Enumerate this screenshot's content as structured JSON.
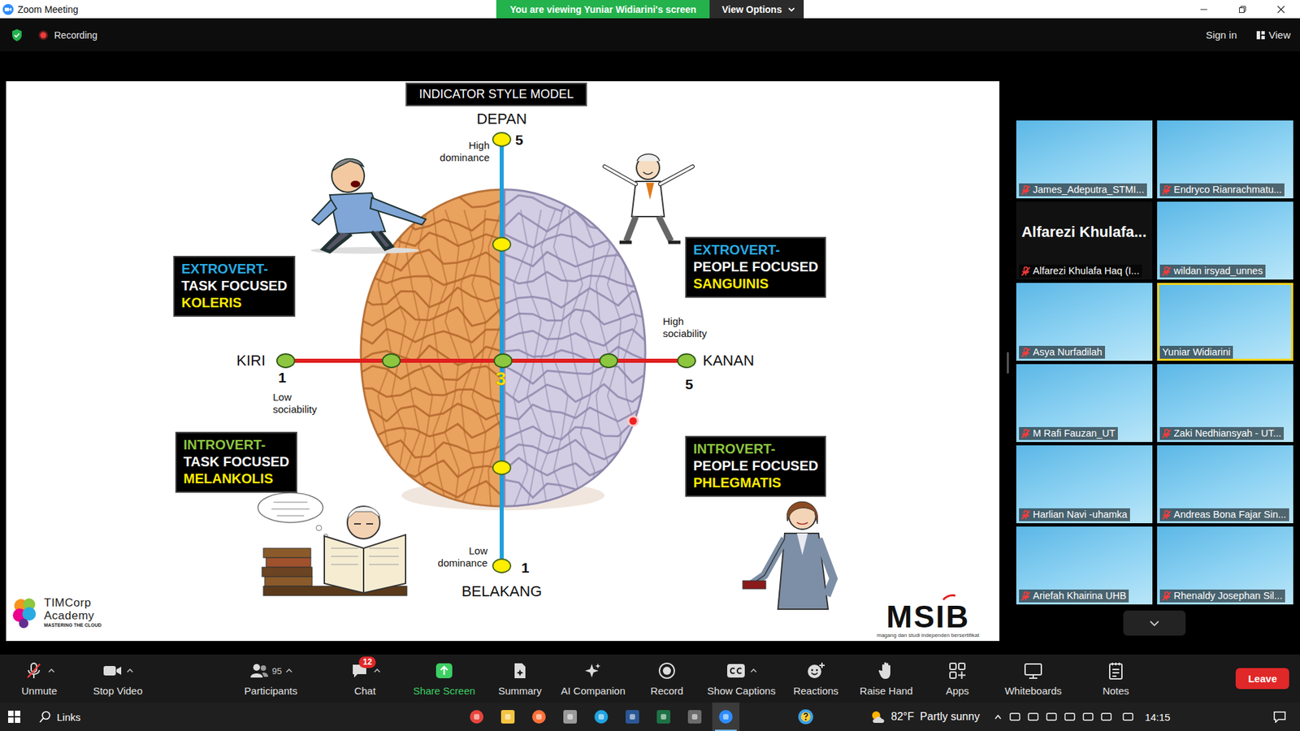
{
  "window": {
    "title": "Zoom Meeting"
  },
  "share_banner": {
    "text": "You are viewing Yuniar Widiarini's screen",
    "options": "View Options"
  },
  "top_bar": {
    "recording": "Recording",
    "sign_in": "Sign in",
    "view": "View"
  },
  "slide": {
    "title": "INDICATOR STYLE MODEL",
    "axis": {
      "top": "DEPAN",
      "top_value": "5",
      "top_note": "High dominance",
      "bottom": "BELAKANG",
      "bottom_value": "1",
      "bottom_note": "Low dominance",
      "left": "KIRI",
      "left_value": "1",
      "left_note": "Low sociability",
      "right": "KANAN",
      "right_value": "5",
      "right_note": "High sociability",
      "center_value": "3"
    },
    "quadrants": [
      {
        "line1": "EXTROVERT-",
        "line2": "TASK FOCUSED",
        "type": "KOLERIS",
        "color": "#29abe2"
      },
      {
        "line1": "EXTROVERT-",
        "line2": "PEOPLE FOCUSED",
        "type": "SANGUINIS",
        "color": "#29abe2"
      },
      {
        "line1": "INTROVERT-",
        "line2": "TASK FOCUSED",
        "type": "MELANKOLIS",
        "color": "#8dc63f"
      },
      {
        "line1": "INTROVERT-",
        "line2": "PEOPLE FOCUSED",
        "type": "PHLEGMATIS",
        "color": "#8dc63f"
      }
    ],
    "logo_left": {
      "line1": "TIMCorp",
      "line2": "Academy",
      "tagline": "MASTERING THE CLOUD"
    },
    "logo_right": {
      "name": "MSIB",
      "tagline": "magang dan studi independen bersertifikat"
    }
  },
  "gallery": [
    {
      "name": "James_Adeputra_STMI...",
      "muted": true,
      "speaking": false,
      "video": true
    },
    {
      "name": "Endryco Rianrachmatu...",
      "muted": true,
      "speaking": false,
      "video": true
    },
    {
      "name": "Alfarezi Khulafa Haq (I...",
      "display_name": "Alfarezi  Khulafa...",
      "muted": true,
      "speaking": false,
      "video": false
    },
    {
      "name": "wildan irsyad_unnes",
      "muted": true,
      "speaking": false,
      "video": true
    },
    {
      "name": "Asya Nurfadilah",
      "muted": true,
      "speaking": false,
      "video": true
    },
    {
      "name": "Yuniar Widiarini",
      "muted": false,
      "speaking": true,
      "video": true
    },
    {
      "name": "M Rafi Fauzan_UT",
      "muted": true,
      "speaking": false,
      "video": true
    },
    {
      "name": "Zaki Nedhiansyah - UT...",
      "muted": true,
      "speaking": false,
      "video": true
    },
    {
      "name": "Harlian Navi -uhamka",
      "muted": true,
      "speaking": false,
      "video": true
    },
    {
      "name": "Andreas Bona Fajar Sin...",
      "muted": true,
      "speaking": false,
      "video": true
    },
    {
      "name": "Ariefah Khairina UHB",
      "muted": true,
      "speaking": false,
      "video": true
    },
    {
      "name": "Rhenaldy Josephan Sil...",
      "muted": true,
      "speaking": false,
      "video": true
    }
  ],
  "toolbar": {
    "mic_muted": true,
    "video_on": true,
    "items": [
      {
        "label": "Unmute",
        "caret": true,
        "color": "#e2e2e2"
      },
      {
        "label": "Stop Video",
        "caret": true,
        "color": "#e2e2e2"
      },
      {
        "label": "Participants",
        "caret": true,
        "count": "95",
        "color": "#e2e2e2"
      },
      {
        "label": "Chat",
        "caret": true,
        "badge": "12",
        "color": "#e2e2e2"
      },
      {
        "label": "Share Screen",
        "caret": false,
        "color": "#3ccf63"
      },
      {
        "label": "Summary",
        "caret": false,
        "color": "#e2e2e2"
      },
      {
        "label": "AI Companion",
        "caret": false,
        "color": "#e2e2e2"
      },
      {
        "label": "Record",
        "caret": false,
        "color": "#e2e2e2"
      },
      {
        "label": "Show Captions",
        "caret": true,
        "color": "#e2e2e2"
      },
      {
        "label": "Reactions",
        "caret": false,
        "color": "#e2e2e2"
      },
      {
        "label": "Raise Hand",
        "caret": false,
        "color": "#e2e2e2"
      },
      {
        "label": "Apps",
        "caret": false,
        "color": "#e2e2e2"
      },
      {
        "label": "Whiteboards",
        "caret": false,
        "color": "#e2e2e2"
      },
      {
        "label": "Notes",
        "caret": false,
        "color": "#e2e2e2"
      }
    ],
    "leave": "Leave"
  },
  "taskbar": {
    "search": "Links",
    "apps": [
      {
        "color": "#e8453c",
        "selected": false
      },
      {
        "color": "#f4c542",
        "selected": false
      },
      {
        "color": "#ff7139",
        "selected": false
      },
      {
        "color": "#9a9a9a",
        "selected": false
      },
      {
        "color": "#1fa3e0",
        "selected": false
      },
      {
        "color": "#2b5797",
        "selected": false
      },
      {
        "color": "#1e7145",
        "selected": false
      },
      {
        "color": "#6b6b6b",
        "selected": false
      },
      {
        "color": "#2d8cff",
        "selected": true
      }
    ],
    "weather": "82°F  Partly sunny",
    "time": "14:15"
  }
}
